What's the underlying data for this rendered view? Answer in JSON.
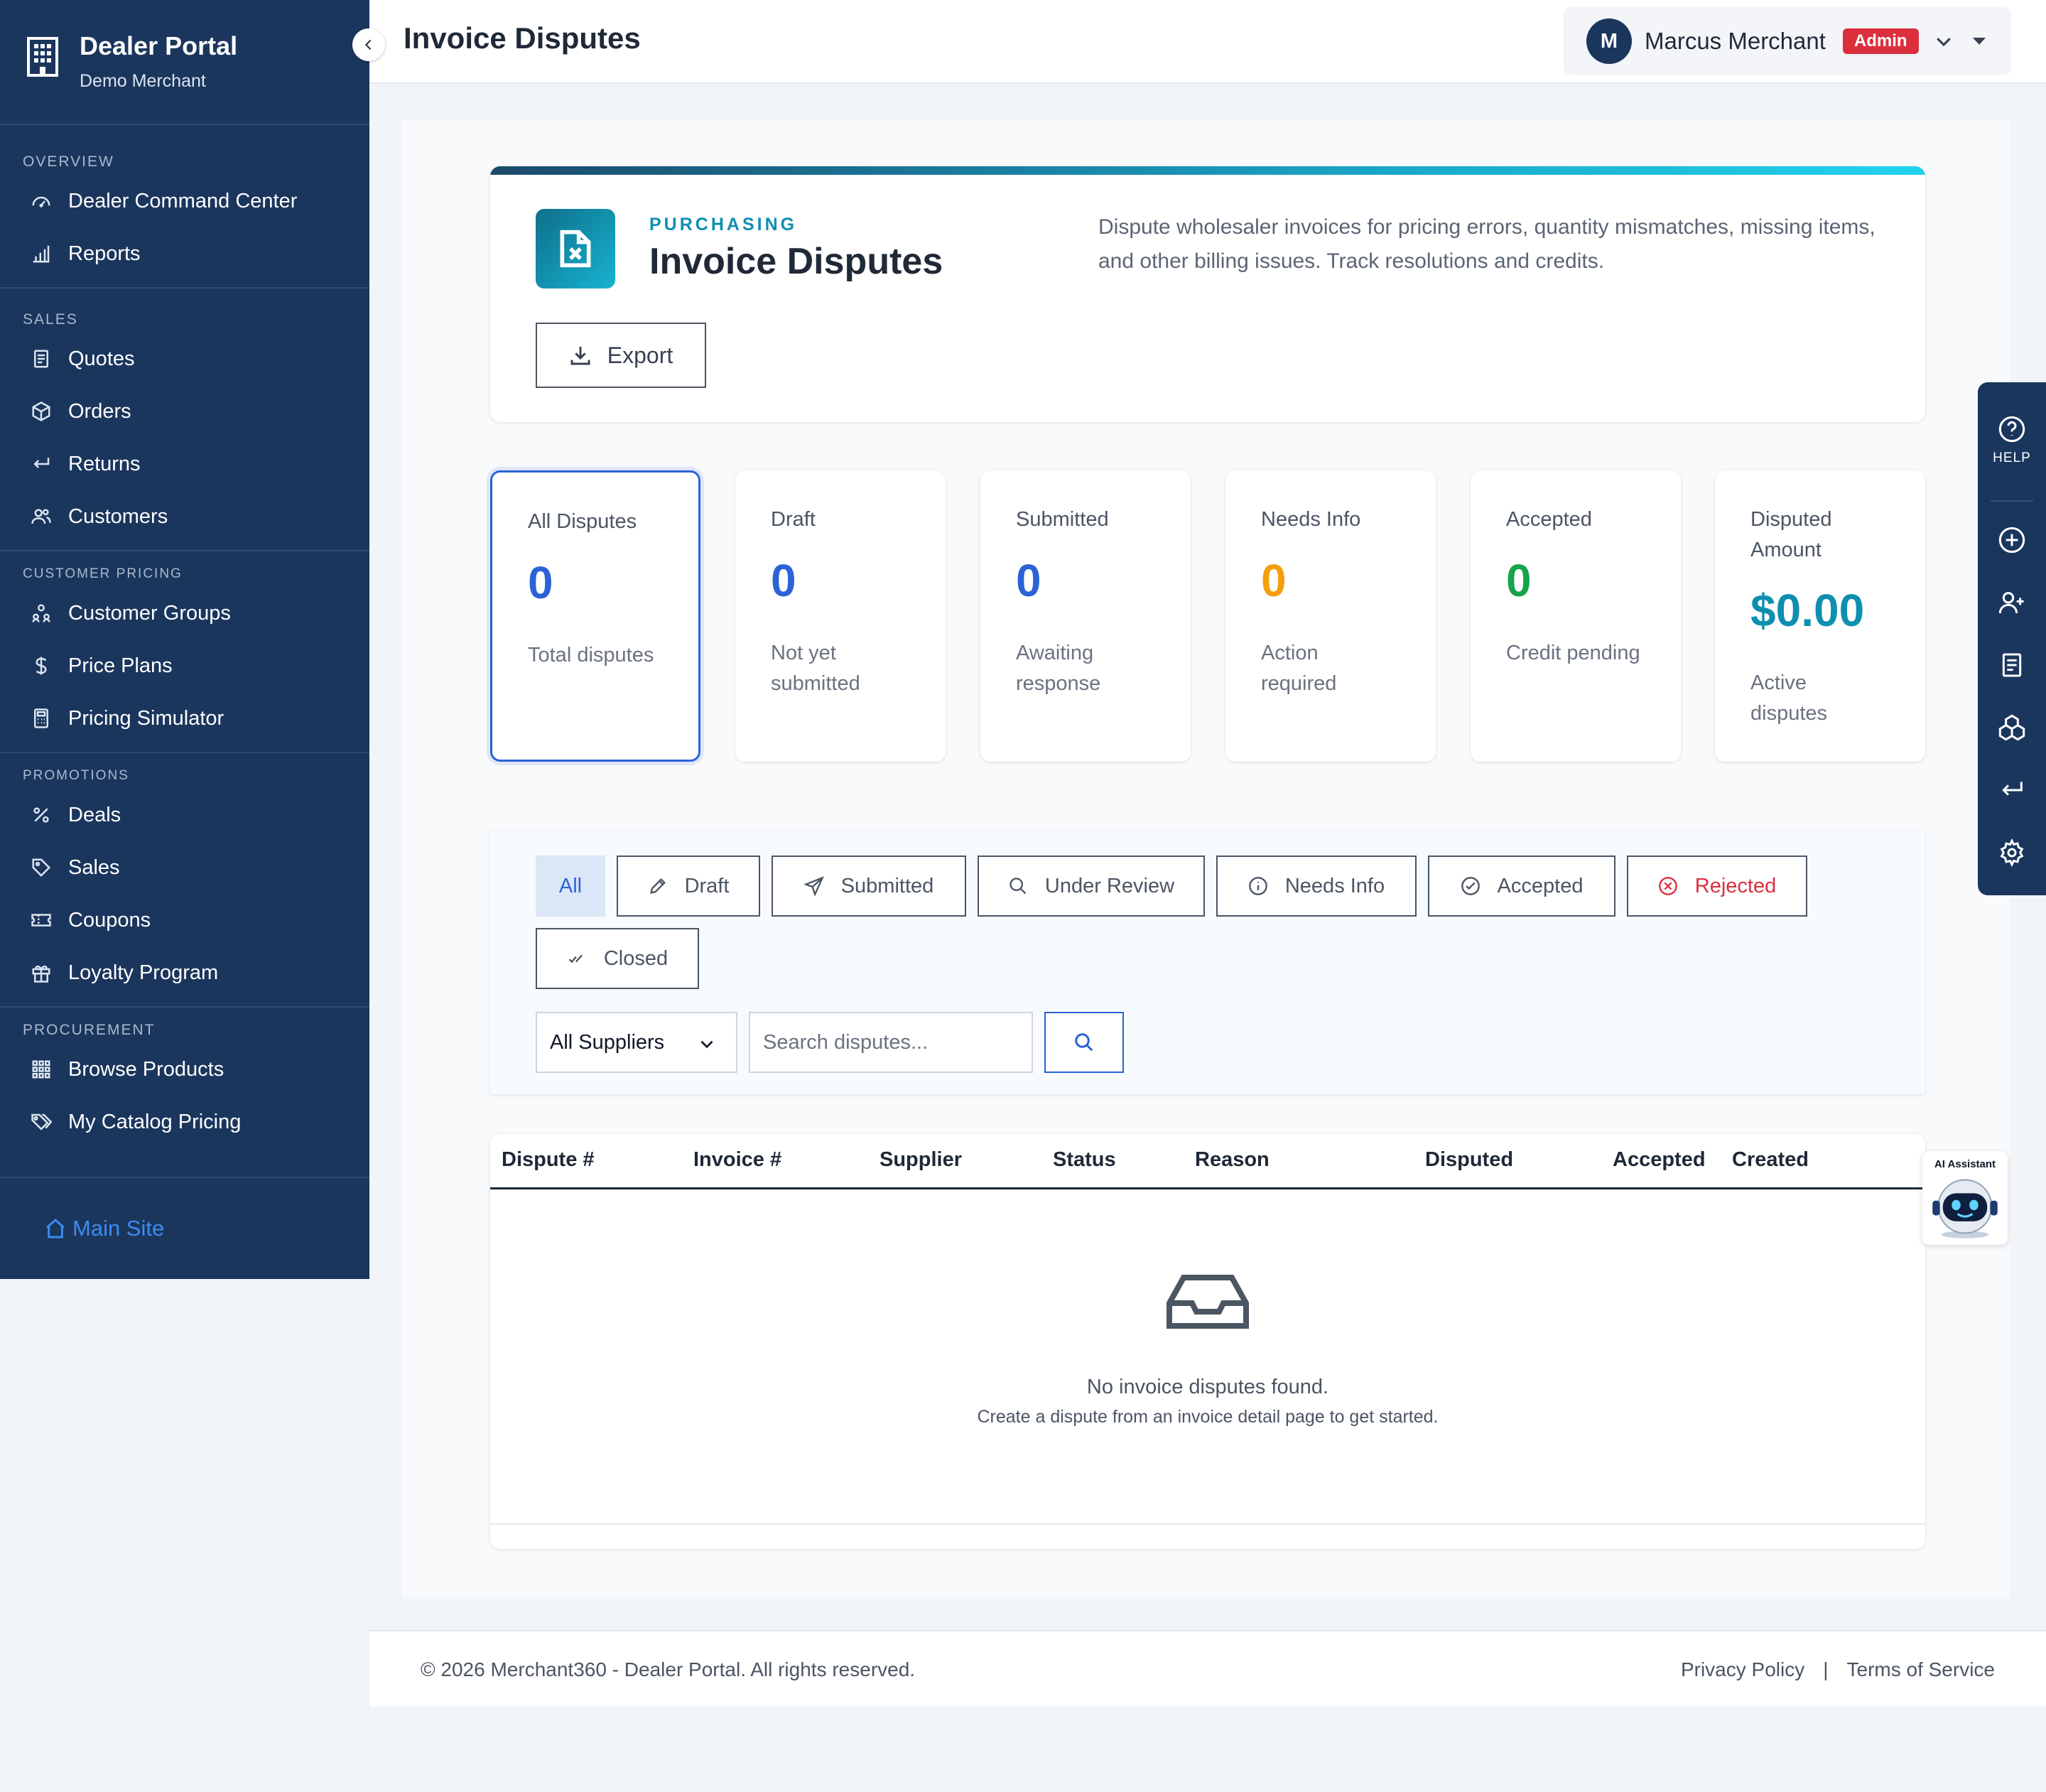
{
  "sidebar": {
    "brand_title": "Dealer Portal",
    "brand_subtitle": "Demo Merchant",
    "sections": {
      "overview": "OVERVIEW",
      "sales": "SALES",
      "customer_pricing": "CUSTOMER PRICING",
      "promotions": "PROMOTIONS",
      "procurement": "PROCUREMENT"
    },
    "items": {
      "command_center": "Dealer Command Center",
      "reports": "Reports",
      "quotes": "Quotes",
      "orders": "Orders",
      "returns": "Returns",
      "customers": "Customers",
      "customer_groups": "Customer Groups",
      "price_plans": "Price Plans",
      "pricing_simulator": "Pricing Simulator",
      "deals": "Deals",
      "sales": "Sales",
      "coupons": "Coupons",
      "loyalty_program": "Loyalty Program",
      "browse_products": "Browse Products",
      "my_catalog_pricing": "My Catalog Pricing"
    },
    "main_site": "Main Site"
  },
  "header": {
    "title": "Invoice Disputes",
    "user_initial": "M",
    "user_name": "Marcus Merchant",
    "role_badge": "Admin"
  },
  "hero": {
    "eyebrow": "PURCHASING",
    "title": "Invoice Disputes",
    "description": "Dispute wholesaler invoices for pricing errors, quantity mismatches, missing items, and other billing issues. Track resolutions and credits.",
    "export_label": "Export"
  },
  "stats": {
    "all": {
      "label": "All Disputes",
      "value": "0",
      "sub": "Total disputes"
    },
    "draft": {
      "label": "Draft",
      "value": "0",
      "sub": "Not yet submitted"
    },
    "submitted": {
      "label": "Submitted",
      "value": "0",
      "sub": "Awaiting response"
    },
    "needs_info": {
      "label": "Needs Info",
      "value": "0",
      "sub": "Action required"
    },
    "accepted": {
      "label": "Accepted",
      "value": "0",
      "sub": "Credit pending"
    },
    "amount": {
      "label": "Disputed Amount",
      "value": "$0.00",
      "sub": "Active disputes"
    }
  },
  "colors": {
    "blue": "#2b62d6",
    "orange": "#f59e0b",
    "green": "#16a34a",
    "teal": "#0e8fb0",
    "danger": "#dc2f3e",
    "sidebar": "#1b365d"
  },
  "filters": {
    "all": "All",
    "draft": "Draft",
    "submitted": "Submitted",
    "under_review": "Under Review",
    "needs_info": "Needs Info",
    "accepted": "Accepted",
    "rejected": "Rejected",
    "closed": "Closed",
    "supplier_select": "All Suppliers",
    "search_placeholder": "Search disputes..."
  },
  "table": {
    "columns": [
      "Dispute #",
      "Invoice #",
      "Supplier",
      "Status",
      "Reason",
      "Disputed",
      "Accepted",
      "Created"
    ],
    "empty_title": "No invoice disputes found.",
    "empty_subtitle": "Create a dispute from an invoice detail page to get started."
  },
  "rail": {
    "help_label": "HELP"
  },
  "ai_assistant": {
    "label": "AI Assistant"
  },
  "footer": {
    "copyright": "© 2026 Merchant360 - Dealer Portal. All rights reserved.",
    "privacy": "Privacy Policy",
    "sep": "|",
    "terms": "Terms of Service"
  }
}
